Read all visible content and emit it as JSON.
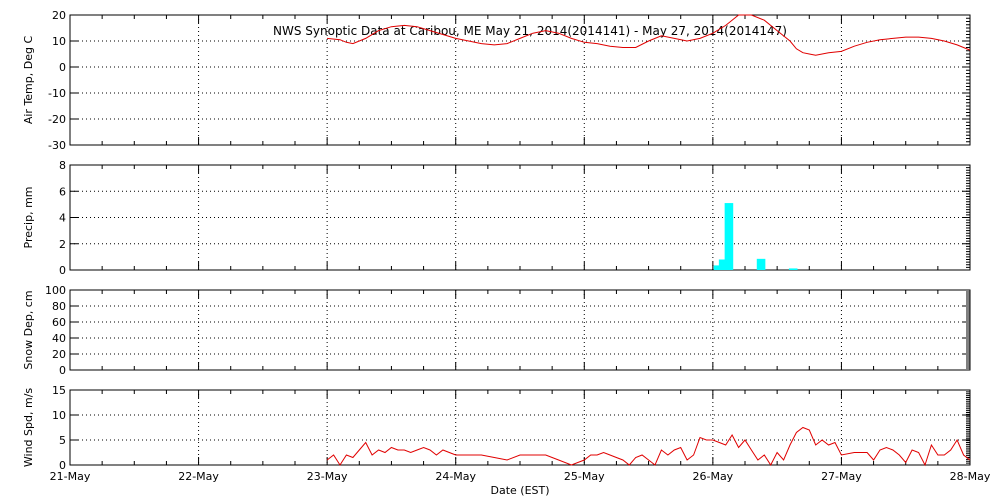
{
  "title": "NWS Synoptic Data at Caribou, ME   May 21, 2014(2014141) - May 27, 2014(2014147)",
  "xlabel": "Date (EST)",
  "x_tick_labels": [
    "21-May",
    "22-May",
    "23-May",
    "24-May",
    "25-May",
    "26-May",
    "27-May",
    "28-May"
  ],
  "colors": {
    "temp": "#e00000",
    "precip": "#00ffff",
    "wind": "#e00000",
    "axes": "#000000"
  },
  "chart_data": [
    {
      "type": "line",
      "name": "air_temp",
      "ylabel": "Air Temp, Deg C",
      "ylim": [
        -30,
        20
      ],
      "yticks": [
        -30,
        -20,
        -10,
        0,
        10,
        20
      ],
      "xlim": [
        0,
        7
      ],
      "grid": true,
      "series": [
        {
          "x": [
            2.0,
            2.1,
            2.15,
            2.2,
            2.3,
            2.4,
            2.5,
            2.6,
            2.7,
            2.8,
            2.9,
            3.0,
            3.1,
            3.2,
            3.3,
            3.4,
            3.5,
            3.6,
            3.7,
            3.8,
            3.9,
            4.0,
            4.1,
            4.2,
            4.3,
            4.4,
            4.5,
            4.6,
            4.7,
            4.8,
            4.9,
            5.0,
            5.1,
            5.2,
            5.3,
            5.4,
            5.5,
            5.6,
            5.65,
            5.7,
            5.75,
            5.8,
            5.9,
            6.0,
            6.1,
            6.2,
            6.3,
            6.4,
            6.5,
            6.6,
            6.7,
            6.8,
            6.9,
            7.0
          ],
          "y": [
            11,
            10.5,
            9.5,
            9,
            11,
            14,
            15.5,
            16,
            15.5,
            14,
            12.5,
            11,
            10,
            9,
            8.5,
            9,
            11,
            13,
            14,
            13,
            11,
            9.5,
            9,
            8,
            7.5,
            7.5,
            10,
            12,
            11,
            10,
            11,
            13,
            16,
            20,
            20,
            18,
            14,
            10,
            7,
            5.5,
            5,
            4.5,
            5.5,
            6,
            8,
            9.5,
            10.5,
            11,
            11.5,
            11.5,
            11,
            10,
            8.5,
            6.5
          ]
        }
      ]
    },
    {
      "type": "bar",
      "name": "precip",
      "ylabel": "Precip, mm",
      "ylim": [
        0,
        8
      ],
      "yticks": [
        0,
        2,
        4,
        6,
        8
      ],
      "xlim": [
        0,
        7
      ],
      "grid": true,
      "series": [
        {
          "x": [
            5.04,
            5.08,
            5.125,
            5.375,
            5.625
          ],
          "y": [
            0.35,
            0.8,
            5.1,
            0.85,
            0.12
          ]
        }
      ]
    },
    {
      "type": "line",
      "name": "snow_depth",
      "ylabel": "Snow Dep, cm",
      "ylim": [
        0,
        100
      ],
      "yticks": [
        0,
        20,
        40,
        60,
        80,
        100
      ],
      "xlim": [
        0,
        7
      ],
      "grid": true,
      "series": [
        {
          "x": [],
          "y": []
        }
      ]
    },
    {
      "type": "line",
      "name": "wind_speed",
      "ylabel": "Wind Spd, m/s",
      "ylim": [
        0,
        15
      ],
      "yticks": [
        0,
        5,
        10,
        15
      ],
      "xlim": [
        0,
        7
      ],
      "grid": true,
      "series": [
        {
          "x": [
            2.0,
            2.05,
            2.1,
            2.15,
            2.2,
            2.25,
            2.3,
            2.35,
            2.4,
            2.45,
            2.5,
            2.55,
            2.6,
            2.65,
            2.7,
            2.75,
            2.8,
            2.85,
            2.9,
            2.95,
            3.0,
            3.1,
            3.2,
            3.3,
            3.4,
            3.5,
            3.6,
            3.7,
            3.8,
            3.9,
            4.0,
            4.05,
            4.1,
            4.15,
            4.2,
            4.25,
            4.3,
            4.35,
            4.4,
            4.45,
            4.5,
            4.55,
            4.6,
            4.65,
            4.7,
            4.75,
            4.8,
            4.85,
            4.9,
            4.95,
            5.0,
            5.05,
            5.1,
            5.15,
            5.2,
            5.25,
            5.3,
            5.35,
            5.4,
            5.45,
            5.5,
            5.55,
            5.6,
            5.65,
            5.7,
            5.75,
            5.8,
            5.85,
            5.9,
            5.95,
            6.0,
            6.1,
            6.2,
            6.25,
            6.3,
            6.35,
            6.4,
            6.45,
            6.5,
            6.55,
            6.6,
            6.65,
            6.7,
            6.75,
            6.8,
            6.85,
            6.9,
            6.95,
            7.0
          ],
          "y": [
            1,
            2,
            0,
            2,
            1.5,
            3,
            4.5,
            2,
            3,
            2.5,
            3.5,
            3,
            3,
            2.5,
            3,
            3.5,
            3,
            2,
            3,
            2.5,
            2,
            2,
            2,
            1.5,
            1,
            2,
            2,
            2,
            1,
            0,
            1,
            2,
            2,
            2.5,
            2,
            1.5,
            1,
            0,
            1.5,
            2,
            1,
            0,
            3,
            2,
            3,
            3.5,
            1,
            2,
            5.5,
            5,
            5,
            4.5,
            4,
            6,
            3.5,
            5,
            3,
            1,
            2,
            0,
            2.5,
            1,
            4,
            6.5,
            7.5,
            7,
            4,
            5,
            4,
            4.5,
            2,
            2.5,
            2.5,
            1,
            3,
            3.5,
            3,
            2,
            0.5,
            3,
            2.5,
            0,
            4,
            2,
            2,
            3,
            5,
            2,
            1
          ]
        }
      ]
    }
  ]
}
